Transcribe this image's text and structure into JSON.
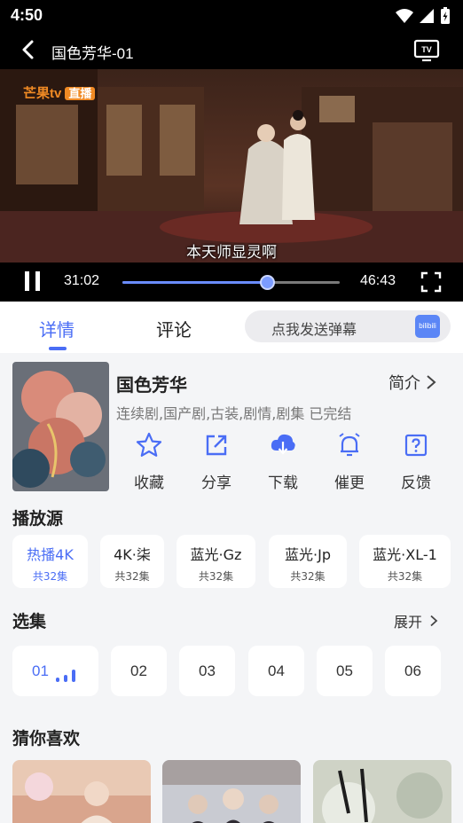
{
  "status": {
    "time": "4:50"
  },
  "titlebar": {
    "title": "国色芳华-01"
  },
  "video": {
    "logo_text": "芒果tv",
    "logo_badge": "直播",
    "subtitle": "本天师显灵啊",
    "current_time": "31:02",
    "duration": "46:43",
    "progress": 0.664
  },
  "tabs": [
    {
      "label": "详情",
      "active": true
    },
    {
      "label": "评论",
      "active": false
    }
  ],
  "danmu": {
    "placeholder": "点我发送弹幕",
    "icon": "bilibili-icon"
  },
  "show": {
    "title": "国色芳华",
    "intro": "简介",
    "tags": "连续剧,国产剧,古装,剧情,剧集 已完结",
    "actions": [
      {
        "label": "收藏",
        "icon": "star-icon"
      },
      {
        "label": "分享",
        "icon": "share-icon"
      },
      {
        "label": "下载",
        "icon": "cloud-download-icon"
      },
      {
        "label": "催更",
        "icon": "bell-icon"
      },
      {
        "label": "反馈",
        "icon": "question-icon"
      }
    ]
  },
  "sources": {
    "title": "播放源",
    "items": [
      {
        "name": "热播4K",
        "count": "共32集",
        "selected": true
      },
      {
        "name": "4K·柒",
        "count": "共32集",
        "selected": false
      },
      {
        "name": "蓝光·Gz",
        "count": "共32集",
        "selected": false
      },
      {
        "name": "蓝光·Jp",
        "count": "共32集",
        "selected": false
      },
      {
        "name": "蓝光·XL-1",
        "count": "共32集",
        "selected": false
      }
    ]
  },
  "episodes": {
    "title": "选集",
    "expand": "展开",
    "items": [
      "01",
      "02",
      "03",
      "04",
      "05",
      "06"
    ],
    "selected_index": 0
  },
  "recommend": {
    "title": "猜你喜欢"
  },
  "colors": {
    "accent": "#4a6df5",
    "background": "#f4f5f7",
    "card": "#ffffff"
  }
}
